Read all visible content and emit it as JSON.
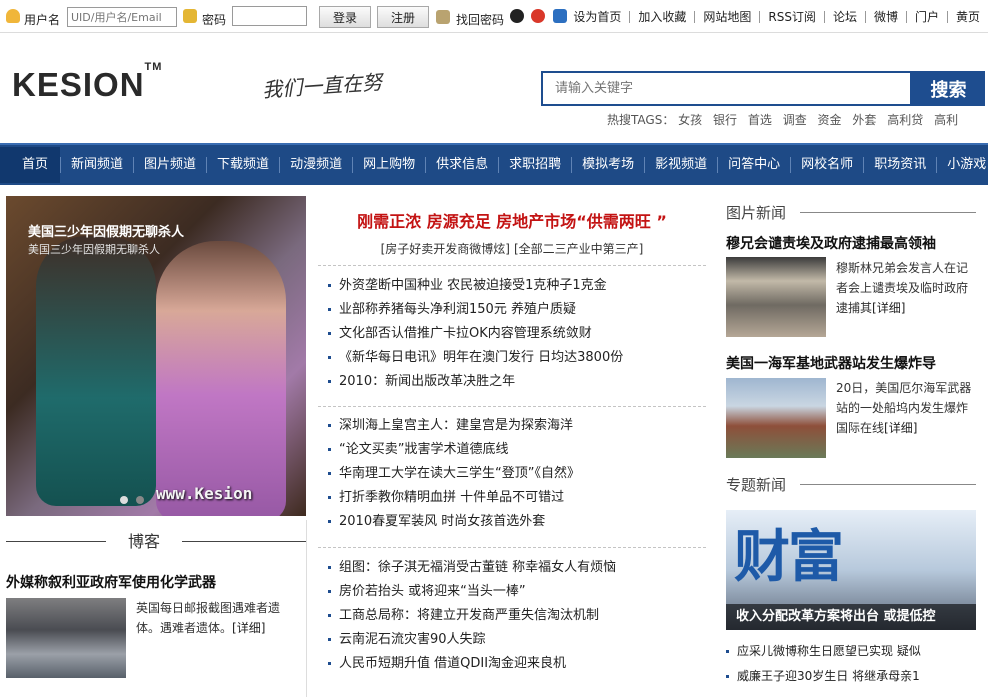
{
  "topbar": {
    "username_label": "用户名",
    "username_placeholder": "UID/用户名/Email",
    "password_label": "密码",
    "login": "登录",
    "register": "注册",
    "recover": "找回密码",
    "links": [
      "设为首页",
      "加入收藏",
      "网站地图",
      "RSS订阅",
      "论坛",
      "微博",
      "门户",
      "黄页"
    ]
  },
  "header": {
    "logo": "KESION",
    "logo_tm": "TM",
    "slogan": "我们一直在努",
    "search_placeholder": "请输入关键字",
    "search_button": "搜索",
    "hot_label": "热搜TAGS：",
    "hot_tags": [
      "女孩",
      "银行",
      "首选",
      "调查",
      "资金",
      "外套",
      "高利贷",
      "高利"
    ]
  },
  "nav": [
    "首页",
    "新闻频道",
    "图片频道",
    "下载频道",
    "动漫频道",
    "网上购物",
    "供求信息",
    "求职招聘",
    "模拟考场",
    "影视频道",
    "问答中心",
    "网校名师",
    "职场资讯",
    "小游戏"
  ],
  "left": {
    "slide_title": "美国三少年因假期无聊杀人",
    "slide_sub": "美国三少年因假期无聊杀人",
    "watermark": "www.Kesion",
    "blog_heading": "博客",
    "news_title": "外媒称叙利亚政府军使用化学武器",
    "news_desc": "英国每日邮报截图遇难者遗体。遇难者遗体。",
    "more": "[详细]"
  },
  "middle": {
    "headline": "刚需正浓  房源充足  房地产市场“供需两旺 ”",
    "sub1": "[房子好卖开发商微博炫]",
    "sub2": "[全部二三产业中第三产]",
    "group1": [
      "外资垄断中国种业 农民被迫接受1克种子1克金",
      "业部称养猪每头净利润150元 养殖户质疑",
      "文化部否认借推广卡拉OK内容管理系统敛财",
      "《新华每日电讯》明年在澳门发行 日均达3800份",
      "2010：新闻出版改革决胜之年"
    ],
    "group2": [
      "深圳海上皇宫主人：建皇宫是为探索海洋",
      "“论文买卖”戕害学术道德底线",
      "华南理工大学在读大三学生“登顶”《自然》",
      "打折季教你精明血拼 十件单品不可错过",
      "2010春夏军装风 时尚女孩首选外套"
    ],
    "group3": [
      "组图：徐子淇无福消受古董链 称幸福女人有烦恼",
      "房价若抬头 或将迎来“当头一棒”",
      "工商总局称：将建立开发商严重失信淘汰机制",
      "云南泥石流灾害90人失踪",
      "人民币短期升值 借道QDII淘金迎来良机"
    ]
  },
  "right": {
    "photo_news_heading": "图片新闻",
    "item1_title": "穆兄会谴责埃及政府逮捕最高领袖",
    "item1_desc": "穆斯林兄弟会发言人在记者会上谴责埃及临时政府逮捕其",
    "item2_title": "美国一海军基地武器站发生爆炸导",
    "item2_desc": "20日，美国厄尔海军武器站的一处船坞内发生爆炸国际在线",
    "more": "[详细]",
    "topic_heading": "专题新闻",
    "topic_word": "财富",
    "topic_caption": "收入分配改革方案将出台 或提低控",
    "topic_list": [
      "应采儿微博称生日愿望已实现 疑似",
      "威廉王子迎30岁生日 将继承母亲1"
    ]
  }
}
